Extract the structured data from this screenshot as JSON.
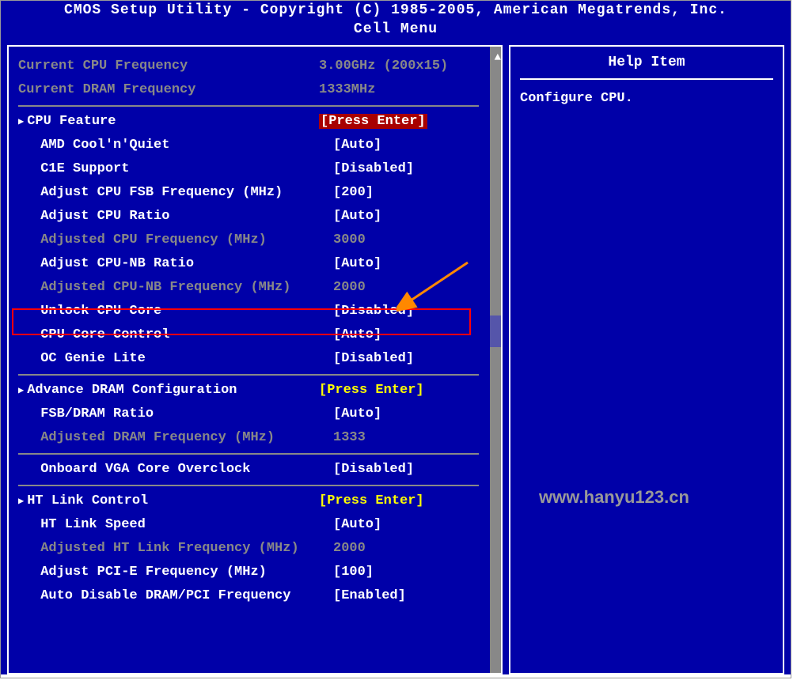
{
  "title": "CMOS Setup Utility - Copyright (C) 1985-2005, American Megatrends, Inc.",
  "menuTitle": "Cell Menu",
  "helpTitle": "Help Item",
  "helpText": "Configure CPU.",
  "watermark": "www.hanyu123.cn",
  "info": {
    "cpuFreqLabel": "Current CPU Frequency",
    "cpuFreqValue": "3.00GHz (200x15)",
    "dramFreqLabel": "Current DRAM Frequency",
    "dramFreqValue": "1333MHz"
  },
  "items": [
    {
      "label": "CPU Feature",
      "value": "[Press Enter]",
      "arrow": true,
      "valueStyle": "highlight-red"
    },
    {
      "label": "AMD Cool'n'Quiet",
      "value": "[Auto]"
    },
    {
      "label": "C1E Support",
      "value": "[Disabled]"
    },
    {
      "label": "Adjust CPU FSB Frequency (MHz)",
      "value": "[200]"
    },
    {
      "label": "Adjust CPU Ratio",
      "value": "[Auto]"
    },
    {
      "label": "Adjusted CPU Frequency (MHz)",
      "value": "3000",
      "dim": true
    },
    {
      "label": "Adjust CPU-NB Ratio",
      "value": "[Auto]"
    },
    {
      "label": "Adjusted CPU-NB Frequency (MHz)",
      "value": "2000",
      "dim": true
    },
    {
      "label": "Unlock CPU Core",
      "value": "[Disabled]"
    },
    {
      "label": "CPU Core Control",
      "value": "[Auto]"
    },
    {
      "label": "OC Genie Lite",
      "value": "[Disabled]"
    }
  ],
  "items2": [
    {
      "label": "Advance DRAM Configuration",
      "value": "[Press Enter]",
      "arrow": true,
      "valueStyle": "yellow"
    },
    {
      "label": "FSB/DRAM Ratio",
      "value": "[Auto]"
    },
    {
      "label": "Adjusted DRAM Frequency (MHz)",
      "value": "1333",
      "dim": true
    }
  ],
  "items3": [
    {
      "label": "Onboard VGA Core Overclock",
      "value": "[Disabled]"
    }
  ],
  "items4": [
    {
      "label": "HT Link Control",
      "value": "[Press Enter]",
      "arrow": true,
      "valueStyle": "yellow"
    },
    {
      "label": "HT Link Speed",
      "value": "[Auto]"
    },
    {
      "label": "Adjusted HT Link Frequency (MHz)",
      "value": "2000",
      "dim": true
    },
    {
      "label": "Adjust PCI-E Frequency (MHz)",
      "value": "[100]"
    },
    {
      "label": "Auto Disable DRAM/PCI Frequency",
      "value": "[Enabled]"
    }
  ]
}
